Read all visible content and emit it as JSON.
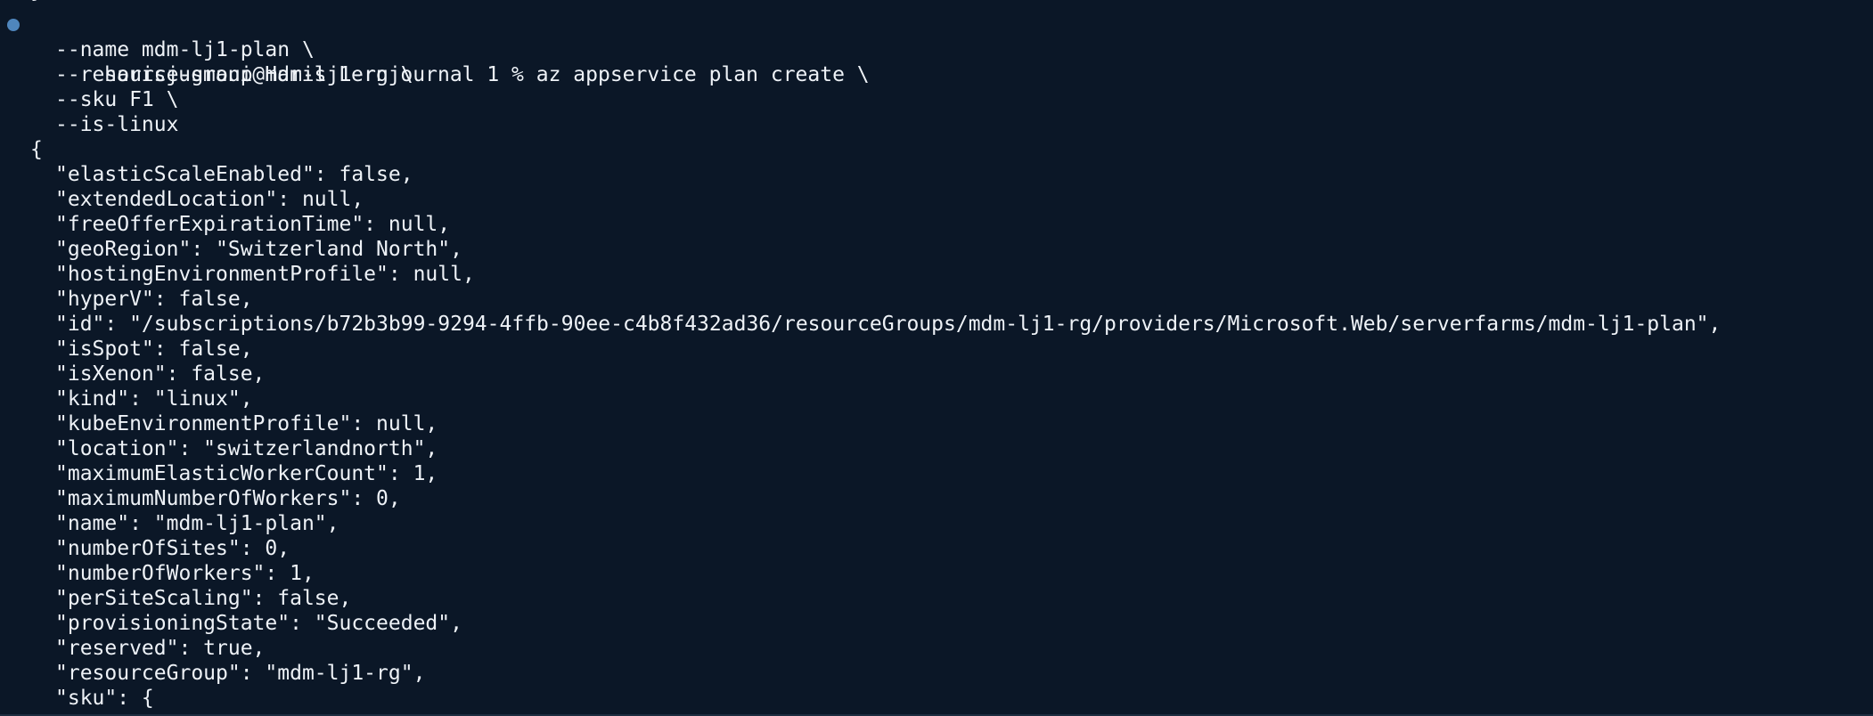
{
  "terminal": {
    "partial_top_line": "}",
    "prompt": "harisjusmani@Haris Lernjournal 1 % ",
    "command": "az appservice plan create \\",
    "args": [
      "--name mdm-lj1-plan \\",
      "--resource-group mdm-lj1-rg \\",
      "--sku F1 \\",
      "--is-linux"
    ],
    "json_open": "{",
    "json_lines": [
      "\"elasticScaleEnabled\": false,",
      "\"extendedLocation\": null,",
      "\"freeOfferExpirationTime\": null,",
      "\"geoRegion\": \"Switzerland North\",",
      "\"hostingEnvironmentProfile\": null,",
      "\"hyperV\": false,",
      "\"id\": \"/subscriptions/b72b3b99-9294-4ffb-90ee-c4b8f432ad36/resourceGroups/mdm-lj1-rg/providers/Microsoft.Web/serverfarms/mdm-lj1-plan\",",
      "\"isSpot\": false,",
      "\"isXenon\": false,",
      "\"kind\": \"linux\",",
      "\"kubeEnvironmentProfile\": null,",
      "\"location\": \"switzerlandnorth\",",
      "\"maximumElasticWorkerCount\": 1,",
      "\"maximumNumberOfWorkers\": 0,",
      "\"name\": \"mdm-lj1-plan\",",
      "\"numberOfSites\": 0,",
      "\"numberOfWorkers\": 1,",
      "\"perSiteScaling\": false,",
      "\"provisioningState\": \"Succeeded\",",
      "\"reserved\": true,",
      "\"resourceGroup\": \"mdm-lj1-rg\",",
      "\"sku\": {"
    ]
  },
  "colors": {
    "background": "#0b1727",
    "text": "#eef2f7",
    "prompt_dot": "#4f86bd"
  }
}
